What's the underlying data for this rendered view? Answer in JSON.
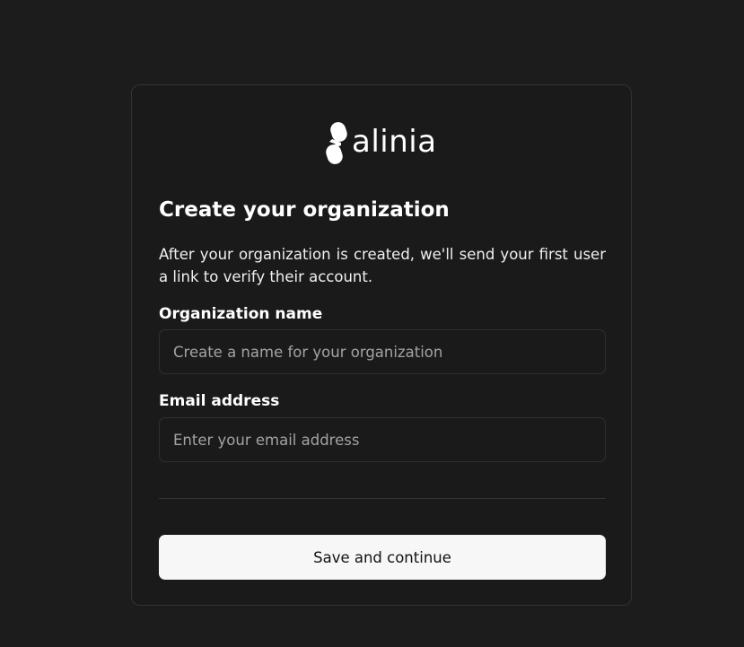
{
  "brand": {
    "logo_text": "alinia",
    "logo_icon": "alinia-mark-icon"
  },
  "form": {
    "title": "Create your organization",
    "description": "After your organization is created, we'll send your first user a link to verify their account.",
    "organization_name": {
      "label": "Organization name",
      "placeholder": "Create a name for your organization",
      "value": ""
    },
    "email": {
      "label": "Email address",
      "placeholder": "Enter your email address",
      "value": ""
    },
    "submit_label": "Save and continue"
  },
  "colors": {
    "background": "#1c1c1c",
    "card_border": "#333333",
    "button_bg": "#f7f7f7",
    "button_text": "#111111",
    "placeholder": "#a3a3a3"
  }
}
